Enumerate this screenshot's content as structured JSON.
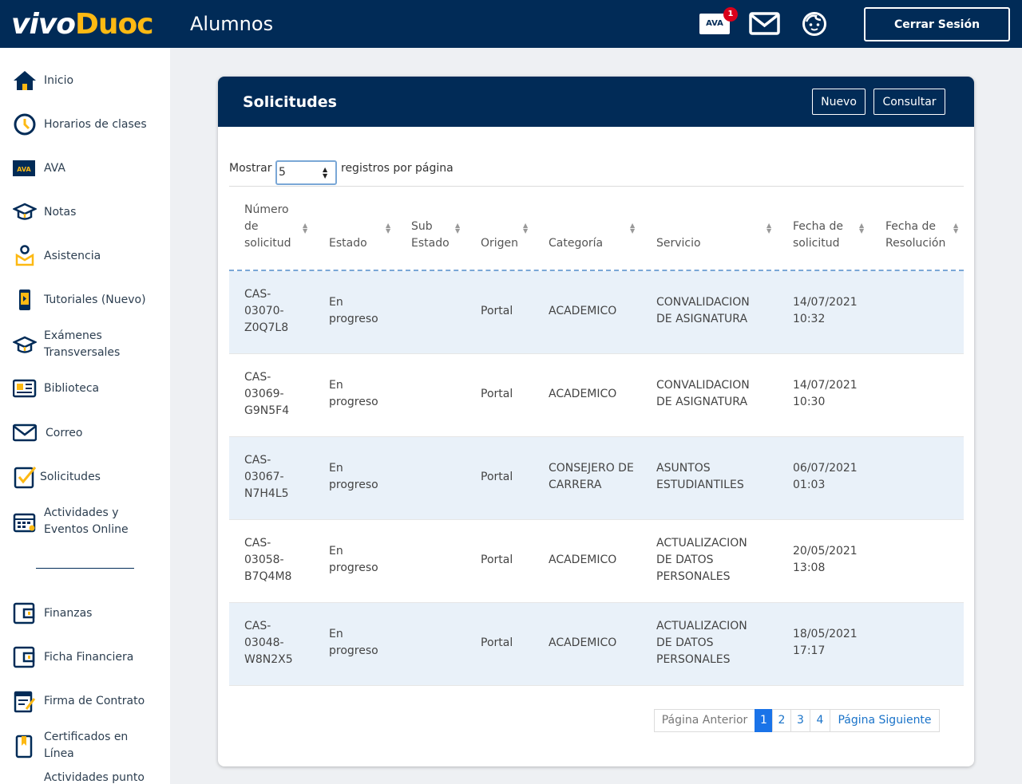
{
  "header": {
    "logo_part1": "vivo",
    "logo_part2": "Duoc",
    "title": "Alumnos",
    "ava_label": "AVA",
    "ava_badge": "1",
    "logout_label": "Cerrar Sesión"
  },
  "sidebar": {
    "items": [
      {
        "label": "Inicio",
        "icon": "home-icon"
      },
      {
        "label": "Horarios de clases",
        "icon": "clock-icon"
      },
      {
        "label": "AVA",
        "icon": "ava-icon"
      },
      {
        "label": "Notas",
        "icon": "graduation-cap-icon"
      },
      {
        "label": "Asistencia",
        "icon": "attendance-icon"
      },
      {
        "label": "Tutoriales (Nuevo)",
        "icon": "phone-tutorial-icon"
      },
      {
        "label": "Exámenes Transversales",
        "icon": "graduation-cap-icon"
      },
      {
        "label": "Biblioteca",
        "icon": "book-icon"
      },
      {
        "label": "Correo",
        "icon": "mail-icon"
      },
      {
        "label": "Solicitudes",
        "icon": "checkbox-icon"
      },
      {
        "label": "Actividades y Eventos Online",
        "icon": "calendar-icon"
      },
      {
        "label": "Finanzas",
        "icon": "wallet-icon"
      },
      {
        "label": "Ficha Financiera",
        "icon": "wallet-icon"
      },
      {
        "label": "Firma de Contrato",
        "icon": "contract-icon"
      },
      {
        "label": "Certificados en Línea",
        "icon": "certificate-icon"
      },
      {
        "label": "Actividades punto",
        "icon": "activity-icon"
      }
    ]
  },
  "panel": {
    "title": "Solicitudes",
    "new_label": "Nuevo",
    "consult_label": "Consultar",
    "show_label": "Mostrar",
    "page_size": "5",
    "per_page_label": "registros por página"
  },
  "table": {
    "columns": [
      "Número de solicitud",
      "Estado",
      "Sub Estado",
      "Origen",
      "Categoría",
      "Servicio",
      "Fecha de solicitud",
      "Fecha de Resolución"
    ],
    "rows": [
      {
        "numero": "CAS-03070-Z0Q7L8",
        "estado": "En progreso",
        "sub_estado": "",
        "origen": "Portal",
        "categoria": "ACADEMICO",
        "servicio": "CONVALIDACION DE ASIGNATURA",
        "fecha_solicitud": "14/07/2021 10:32",
        "fecha_resolucion": ""
      },
      {
        "numero": "CAS-03069-G9N5F4",
        "estado": "En progreso",
        "sub_estado": "",
        "origen": "Portal",
        "categoria": "ACADEMICO",
        "servicio": "CONVALIDACION DE ASIGNATURA",
        "fecha_solicitud": "14/07/2021 10:30",
        "fecha_resolucion": ""
      },
      {
        "numero": "CAS-03067-N7H4L5",
        "estado": "En progreso",
        "sub_estado": "",
        "origen": "Portal",
        "categoria": "CONSEJERO DE CARRERA",
        "servicio": "ASUNTOS ESTUDIANTILES",
        "fecha_solicitud": "06/07/2021 01:03",
        "fecha_resolucion": ""
      },
      {
        "numero": "CAS-03058-B7Q4M8",
        "estado": "En progreso",
        "sub_estado": "",
        "origen": "Portal",
        "categoria": "ACADEMICO",
        "servicio": "ACTUALIZACION DE DATOS PERSONALES",
        "fecha_solicitud": "20/05/2021 13:08",
        "fecha_resolucion": ""
      },
      {
        "numero": "CAS-03048-W8N2X5",
        "estado": "En progreso",
        "sub_estado": "",
        "origen": "Portal",
        "categoria": "ACADEMICO",
        "servicio": "ACTUALIZACION DE DATOS PERSONALES",
        "fecha_solicitud": "18/05/2021 17:17",
        "fecha_resolucion": ""
      }
    ]
  },
  "pagination": {
    "prev_label": "Página Anterior",
    "pages": [
      "1",
      "2",
      "3",
      "4"
    ],
    "current_page": "1",
    "next_label": "Página Siguiente"
  },
  "colors": {
    "navy": "#012b57",
    "accent_yellow": "#fdb913",
    "active_page": "#1a73e8",
    "row_alt": "#e9f1f9"
  }
}
